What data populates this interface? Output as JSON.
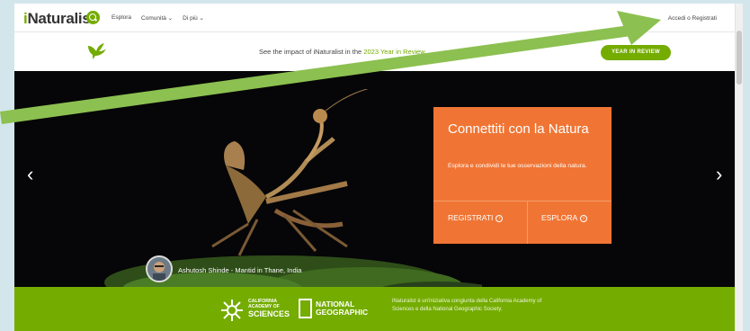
{
  "header": {
    "logo_prefix": "i",
    "logo_rest": "Naturalist",
    "nav": [
      "Esplora",
      "Comunità ⌄",
      "Di più ⌄"
    ],
    "signin": "Accedi o Registrati"
  },
  "banner": {
    "text_before": "See the impact of iNaturalist in the ",
    "link": "2023 Year in Review",
    "text_after": ".",
    "button": "YEAR IN REVIEW"
  },
  "hero": {
    "cta_title": "Connettiti con la Natura",
    "cta_desc": "Esplora e condividi le tue osservazioni della natura.",
    "btn_register": "REGISTRATI",
    "btn_explore": "ESPLORA",
    "arrow_left": "‹",
    "arrow_right": "›",
    "credit": "Ashutosh Shinde  -  Mantid in Thane, India"
  },
  "footer": {
    "cas_line1": "CALIFORNIA",
    "cas_line2": "ACADEMY OF",
    "cas_line3": "SCIENCES",
    "ng_line1": "NATIONAL",
    "ng_line2": "GEOGRAPHIC",
    "text": "iNaturalist è un'iniziativa congiunta della California Academy of Sciences e della National Geographic Society."
  },
  "colors": {
    "brand_green": "#74ac00",
    "cta_orange": "#f07534",
    "annotation_arrow": "#8cc050"
  },
  "icons": [
    "search-icon",
    "bird-logo-icon",
    "chevron-left-icon",
    "chevron-right-icon",
    "arrow-circle-right-icon"
  ]
}
